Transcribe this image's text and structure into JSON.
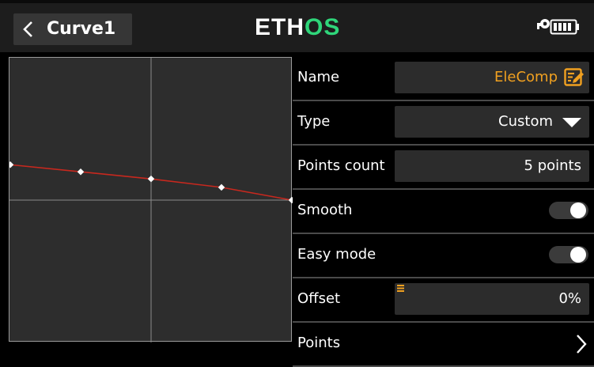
{
  "header": {
    "back_icon": "chevron-left-icon",
    "title": "Curve1",
    "logo_main": "ETH",
    "logo_accent": "OS",
    "logo_accent_color": "#2fd67a",
    "status_icons": [
      "key-icon",
      "battery-icon"
    ]
  },
  "curve": {
    "points": [
      {
        "x": -100,
        "y": 25
      },
      {
        "x": -50,
        "y": 20
      },
      {
        "x": 0,
        "y": 15
      },
      {
        "x": 50,
        "y": 9
      },
      {
        "x": 100,
        "y": 0
      }
    ],
    "x_range": [
      -100,
      100
    ],
    "y_range": [
      -100,
      100
    ],
    "line_color": "#c8281e",
    "crosshair": true
  },
  "settings": {
    "name": {
      "label": "Name",
      "value": "EleComp",
      "value_color": "#f0a020",
      "icon": "edit-icon"
    },
    "type": {
      "label": "Type",
      "value": "Custom",
      "icon": "dropdown-triangle-icon"
    },
    "points_count": {
      "label": "Points count",
      "value": "5 points"
    },
    "smooth": {
      "label": "Smooth",
      "enabled": true
    },
    "easy_mode": {
      "label": "Easy mode",
      "enabled": true
    },
    "offset": {
      "label": "Offset",
      "value": "0%",
      "icon": "menu-lines-icon"
    },
    "points": {
      "label": "Points",
      "icon": "chevron-right-icon"
    }
  }
}
